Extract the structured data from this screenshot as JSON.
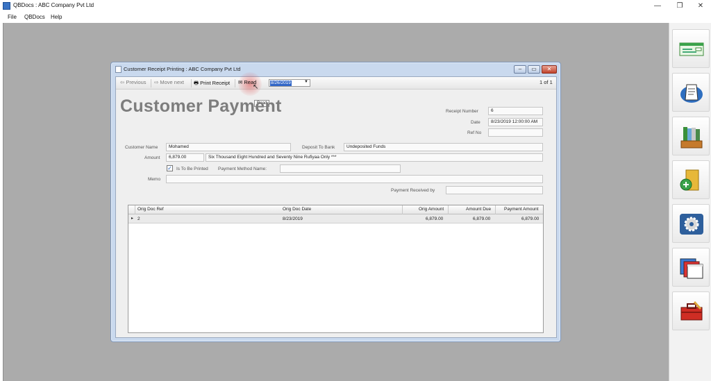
{
  "window": {
    "title": "QBDocs : ABC Company Pvt Ltd",
    "minimize": "—",
    "maximize": "❐",
    "close": "✕"
  },
  "menu": [
    "File",
    "QBDocs",
    "Help"
  ],
  "child_window": {
    "title": "Customer Receipt Printing : ABC Company Pvt Ltd"
  },
  "toolbar": {
    "previous": "Previous",
    "move_next": "Move next",
    "print_receipt": "Print Receipt",
    "read": "Read",
    "date_value": "8/26/2019",
    "pager": "1 of 1",
    "tooltip": "Read"
  },
  "form": {
    "title": "Customer Payment",
    "receipt_number_label": "Receipt Number",
    "receipt_number": "6",
    "date_label": "Date",
    "date": "8/23/2019 12:00:00 AM",
    "ref_no_label": "Ref No",
    "ref_no": "",
    "customer_name_label": "Customer Name",
    "customer_name": "Mohamed",
    "deposit_to_bank_label": "Deposit To Bank",
    "deposit_to_bank": "Undeposited Funds",
    "amount_label": "Amount",
    "amount": "6,879.00",
    "amount_words": "Six Thousand Eight Hundred and Seventy Nine Rufiyaa Only ***",
    "is_to_be_printed_label": "Is To Be Printed",
    "is_to_be_printed": true,
    "payment_method_label": "Payment Method Name:",
    "payment_method": "",
    "memo_label": "Memo",
    "memo": "",
    "payment_received_by_label": "Payment Received by",
    "payment_received_by": ""
  },
  "grid": {
    "columns": [
      "Orig Doc Ref",
      "Orig Doc Date",
      "Orig Amount",
      "Amount Due",
      "Payment Amount"
    ],
    "rows": [
      {
        "ref": "2",
        "date": "8/23/2019",
        "orig_amount": "6,879.00",
        "amount_due": "6,879.00",
        "payment_amount": "6,879.00"
      }
    ]
  },
  "right_toolbar": [
    "cheque-icon",
    "receipt-printer-icon",
    "file-box-icon",
    "add-folder-icon",
    "settings-icon",
    "windows-icon",
    "toolbox-icon"
  ]
}
